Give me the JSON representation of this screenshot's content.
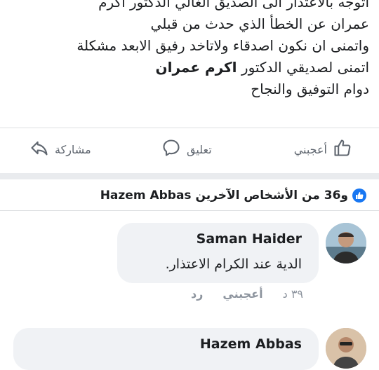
{
  "post": {
    "line1": "اتوجه بالاعتذار الى الصديق الغالي الدكتور اكرم",
    "line2": "عمران عن الخطأ الذي حدث من قبلي",
    "line3": "واتمنى ان نكون اصدقاء ولاتاخد رفيق الابعد مشكلة",
    "line4_prefix": "اتمنى لصديقي الدكتور ",
    "line4_name": "اكرم عمران",
    "line5": "دوام التوفيق والنجاح"
  },
  "actions": {
    "like_label": "أعجبني",
    "comment_label": "تعليق",
    "share_label": "مشاركة"
  },
  "reactions": {
    "summary": "و36 من الأشخاص الآخرين Hazem Abbas"
  },
  "comments": [
    {
      "author": "Saman Haider",
      "text": "الدية عند الكرام الاعتذار.",
      "time": "٣٩ د",
      "like_label": "أعجبني",
      "reply_label": "رد"
    },
    {
      "author": "Hazem Abbas"
    }
  ],
  "colors": {
    "accent": "#1877f2",
    "bubble": "#f0f2f5",
    "muted": "#606770",
    "band": "#e9ebee"
  },
  "icons": [
    "like-icon",
    "comment-icon",
    "share-icon",
    "like-badge-icon"
  ]
}
